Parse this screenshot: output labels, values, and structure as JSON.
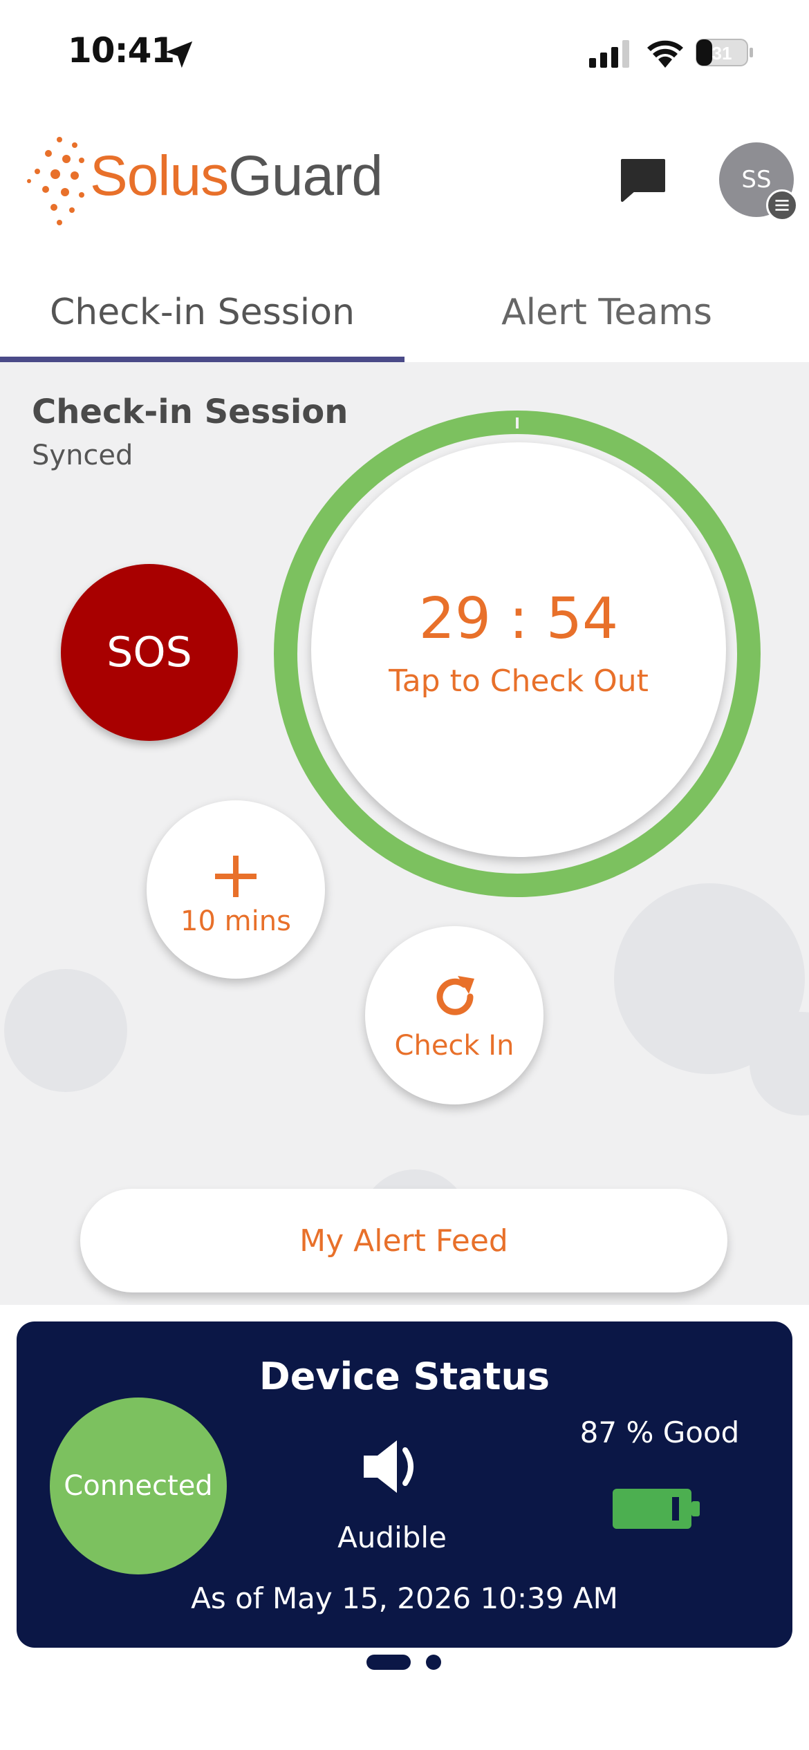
{
  "status_bar": {
    "time": "10:41",
    "battery_level": "31"
  },
  "header": {
    "logo_part1": "Solus",
    "logo_part2": "Guard",
    "avatar_initials": "SS",
    "brand_color": "#e8702a"
  },
  "tabs": [
    {
      "label": "Check-in Session",
      "active": true
    },
    {
      "label": "Alert Teams",
      "active": false
    }
  ],
  "session": {
    "title": "Check-in Session",
    "status": "Synced",
    "timer": "29 : 54",
    "timer_action": "Tap to Check Out",
    "ring_color": "#7cc15f"
  },
  "actions": {
    "sos_label": "SOS",
    "sos_color": "#a80000",
    "add_time_label": "10 mins",
    "check_in_label": "Check In",
    "alert_feed_label": "My Alert Feed"
  },
  "device_status": {
    "title": "Device Status",
    "connection": "Connected",
    "sound": "Audible",
    "battery": "87 % Good",
    "battery_level": 0.87,
    "as_of": "As of May 15, 2026 10:39 AM",
    "panel_color": "#0b1746"
  },
  "icons": {
    "status": [
      "location-arrow-icon",
      "cellular-signal-icon",
      "wifi-icon",
      "battery-icon"
    ],
    "header": [
      "chat-icon",
      "menu-icon"
    ],
    "actions": [
      "plus-icon",
      "refresh-icon"
    ],
    "device": [
      "speaker-icon",
      "battery-full-icon"
    ]
  },
  "pager": {
    "pages": 2,
    "current": 1
  }
}
